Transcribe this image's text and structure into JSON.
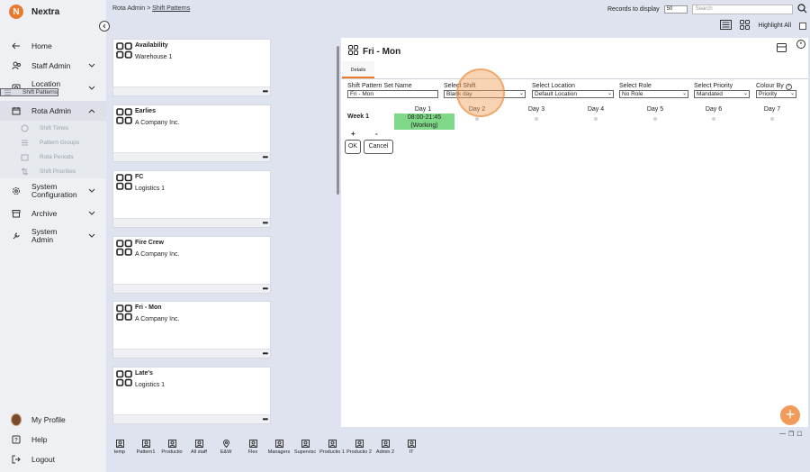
{
  "app": {
    "name": "Nextra"
  },
  "colors": {
    "accent": "#e87b2e",
    "shift_working": "#7ed887"
  },
  "sidebar": {
    "items": [
      {
        "label": "Home",
        "icon": "arrow-left-icon"
      },
      {
        "label": "Staff Admin",
        "icon": "users-icon"
      },
      {
        "label": "Location Admin",
        "icon": "location-icon"
      },
      {
        "label": "Rota Admin",
        "icon": "calendar-icon"
      }
    ],
    "subitems": [
      "Shift Times",
      "Shift Patterns",
      "Pattern Groups",
      "Rota Periods",
      "Shift Priorities"
    ],
    "items2": [
      "System Configuration",
      "Archive",
      "System Admin"
    ],
    "bottom": [
      "My Profile",
      "Help",
      "Logout"
    ]
  },
  "breadcrumb": {
    "root": "Rota Admin >",
    "current": "Shift Patterns"
  },
  "toolbar": {
    "records_label": "Records to display",
    "records_value": "50",
    "search_placeholder": "Search",
    "highlight_label": "Highlight All"
  },
  "cards": [
    {
      "title": "Availability",
      "subtitle": "Warehouse 1"
    },
    {
      "title": "Earlies",
      "subtitle": "A Company Inc."
    },
    {
      "title": "FC",
      "subtitle": "Logistics 1"
    },
    {
      "title": "Fire Crew",
      "subtitle": "A Company Inc."
    },
    {
      "title": "Fri - Mon",
      "subtitle": "A Company Inc."
    },
    {
      "title": "Late's",
      "subtitle": "Logistics 1"
    }
  ],
  "panel": {
    "title": "Fri - Mon",
    "tab": "Details",
    "fields": {
      "set_name_label": "Shift Pattern Set Name",
      "set_name_value": "Fri - Mon",
      "shift_label": "Select Shift",
      "shift_value": "Blank day",
      "location_label": "Select Location",
      "location_value": "Default Location",
      "role_label": "Select Role",
      "role_value": "No Role",
      "priority_label": "Select Priority",
      "priority_value": "Mandated",
      "colour_label": "Colour By",
      "colour_value": "Priority"
    },
    "week_label": "Week 1",
    "days": [
      "Day 1",
      "Day 2",
      "Day 3",
      "Day 4",
      "Day 5",
      "Day 6",
      "Day 7"
    ],
    "shift_time": "08:00-21:45",
    "shift_status": "(Working)",
    "plus": "+",
    "minus": "-",
    "ok": "OK",
    "cancel": "Cancel"
  },
  "bottombar": [
    {
      "label": "temp"
    },
    {
      "label": "Pattern1"
    },
    {
      "label": "Productio"
    },
    {
      "label": "All staff"
    },
    {
      "label": "E&W"
    },
    {
      "label": "Flex"
    },
    {
      "label": "Managers"
    },
    {
      "label": "Supervisc"
    },
    {
      "label": "Productio 1"
    },
    {
      "label": "Productio 2"
    },
    {
      "label": "Admin 2"
    },
    {
      "label": "IT"
    }
  ]
}
